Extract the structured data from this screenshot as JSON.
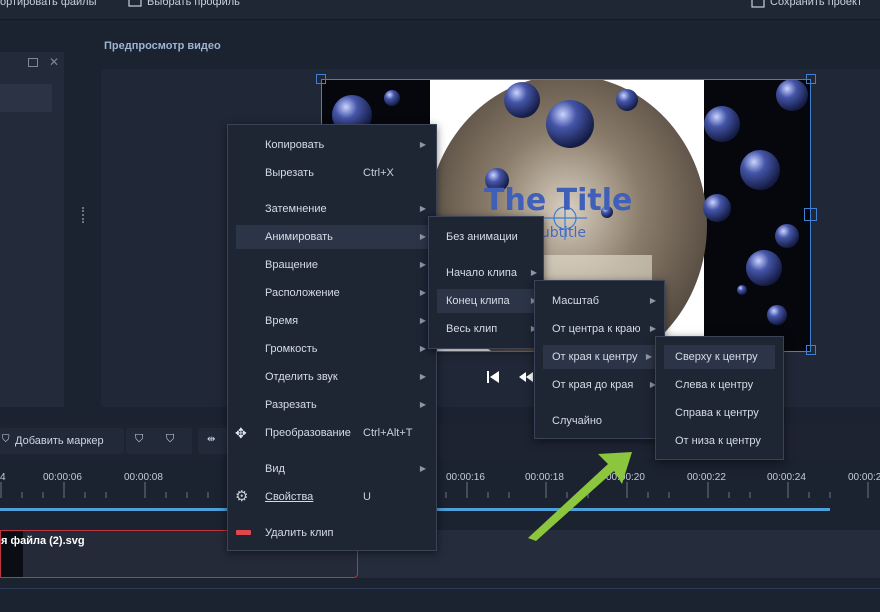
{
  "topbar": {
    "import_label": "ортировать файлы",
    "profile_label": "Выбрать профиль",
    "save_label": "Сохранить проект"
  },
  "preview": {
    "label": "Предпросмотр видео",
    "title_text": "The Title",
    "subtitle_text": "Subtitle"
  },
  "timeline": {
    "marker_button": "Добавить маркер",
    "ticks": [
      "4",
      "00:00:06",
      "00:00:08",
      "00:00:16",
      "00:00:18",
      "00:00:20",
      "00:00:22",
      "00:00:24",
      "00:00:2"
    ],
    "clip_name": "я файла (2).svg"
  },
  "context_menu": {
    "items": [
      {
        "label": "Копировать",
        "shortcut": "",
        "submenu": true
      },
      {
        "label": "Вырезать",
        "shortcut": "Ctrl+X",
        "submenu": false
      },
      {
        "label": "Затемнение",
        "shortcut": "",
        "submenu": true
      },
      {
        "label": "Анимировать",
        "shortcut": "",
        "submenu": true
      },
      {
        "label": "Вращение",
        "shortcut": "",
        "submenu": true
      },
      {
        "label": "Расположение",
        "shortcut": "",
        "submenu": true
      },
      {
        "label": "Время",
        "shortcut": "",
        "submenu": true
      },
      {
        "label": "Громкость",
        "shortcut": "",
        "submenu": true
      },
      {
        "label": "Отделить звук",
        "shortcut": "",
        "submenu": true
      },
      {
        "label": "Разрезать",
        "shortcut": "",
        "submenu": true
      },
      {
        "label": "Преобразование",
        "shortcut": "Ctrl+Alt+T",
        "submenu": false
      },
      {
        "label": "Вид",
        "shortcut": "",
        "submenu": true
      },
      {
        "label": "Свойства",
        "shortcut": "U",
        "submenu": false
      },
      {
        "label": "Удалить клип",
        "shortcut": "",
        "submenu": false
      }
    ]
  },
  "animate_menu": {
    "items": [
      "Без анимации",
      "Начало клипа",
      "Конец клипа",
      "Весь клип"
    ]
  },
  "end_clip_menu": {
    "items": [
      "Масштаб",
      "От центра к краю",
      "От края к центру",
      "От края до края",
      "Случайно"
    ]
  },
  "edge_center_menu": {
    "items": [
      "Сверху к центру",
      "Слева к центру",
      "Справа к центру",
      "От низа к центру"
    ]
  },
  "colors": {
    "accent": "#3f7fd4",
    "arrow": "#8cc63f",
    "delete": "#e0474c"
  }
}
